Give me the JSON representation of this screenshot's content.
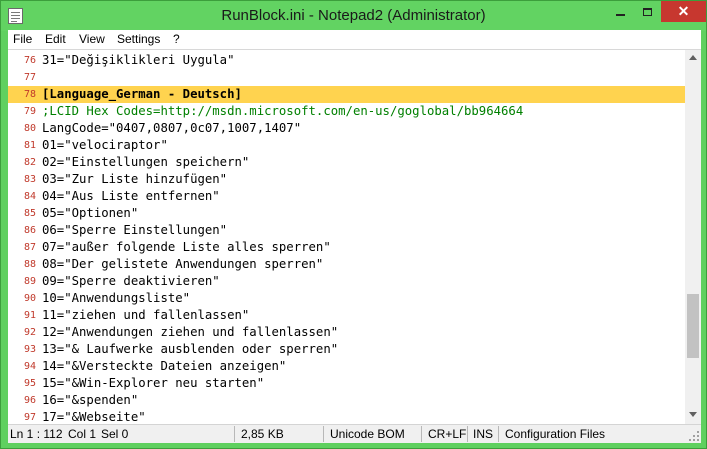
{
  "window": {
    "title": "RunBlock.ini - Notepad2 (Administrator)",
    "close_glyph": "✕"
  },
  "menu": [
    "File",
    "Edit",
    "View",
    "Settings",
    "?"
  ],
  "editor": {
    "highlight_color": "#ffd34f",
    "lines": [
      {
        "num": "76",
        "text": "31=\"Değişiklikleri Uygula\"",
        "style": "normal"
      },
      {
        "num": "77",
        "text": "",
        "style": "normal"
      },
      {
        "num": "78",
        "text": "[Language_German - Deutsch]",
        "style": "section",
        "highlight": true
      },
      {
        "num": "79",
        "text": ";LCID Hex Codes=http://msdn.microsoft.com/en-us/goglobal/bb964664",
        "style": "comment"
      },
      {
        "num": "80",
        "text": "LangCode=\"0407,0807,0c07,1007,1407\"",
        "style": "normal"
      },
      {
        "num": "81",
        "text": "01=\"velociraptor\"",
        "style": "normal"
      },
      {
        "num": "82",
        "text": "02=\"Einstellungen speichern\"",
        "style": "normal"
      },
      {
        "num": "83",
        "text": "03=\"Zur Liste hinzufügen\"",
        "style": "normal"
      },
      {
        "num": "84",
        "text": "04=\"Aus Liste entfernen\"",
        "style": "normal"
      },
      {
        "num": "85",
        "text": "05=\"Optionen\"",
        "style": "normal"
      },
      {
        "num": "86",
        "text": "06=\"Sperre Einstellungen\"",
        "style": "normal"
      },
      {
        "num": "87",
        "text": "07=\"außer folgende Liste alles sperren\"",
        "style": "normal"
      },
      {
        "num": "88",
        "text": "08=\"Der gelistete Anwendungen sperren\"",
        "style": "normal"
      },
      {
        "num": "89",
        "text": "09=\"Sperre deaktivieren\"",
        "style": "normal"
      },
      {
        "num": "90",
        "text": "10=\"Anwendungsliste\"",
        "style": "normal"
      },
      {
        "num": "91",
        "text": "11=\"ziehen und fallenlassen\"",
        "style": "normal"
      },
      {
        "num": "92",
        "text": "12=\"Anwendungen ziehen und fallenlassen\"",
        "style": "normal"
      },
      {
        "num": "93",
        "text": "13=\"& Laufwerke ausblenden oder sperren\"",
        "style": "normal"
      },
      {
        "num": "94",
        "text": "14=\"&Versteckte Dateien anzeigen\"",
        "style": "normal"
      },
      {
        "num": "95",
        "text": "15=\"&Win-Explorer neu starten\"",
        "style": "normal"
      },
      {
        "num": "96",
        "text": "16=\"&spenden\"",
        "style": "normal"
      },
      {
        "num": "97",
        "text": "17=\"&Webseite\"",
        "style": "normal"
      }
    ]
  },
  "status": {
    "position": "Ln 1 : 112",
    "column": "Col 1",
    "selection": "Sel 0",
    "size": "2,85 KB",
    "encoding": "Unicode BOM",
    "line_endings": "CR+LF",
    "insert_mode": "INS",
    "scheme": "Configuration Files"
  }
}
